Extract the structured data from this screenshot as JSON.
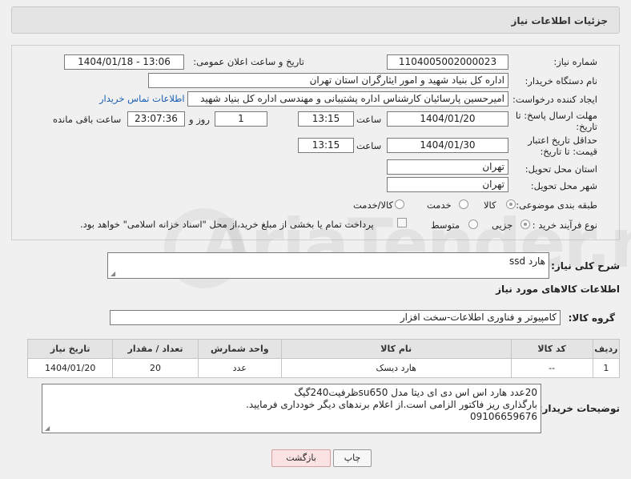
{
  "header": {
    "title": "جزئیات اطلاعات نیاز"
  },
  "form": {
    "need_number_label": "شماره نیاز:",
    "need_number": "1104005002000023",
    "announce_label": "تاریخ و ساعت اعلان عمومی:",
    "announce_value": "1404/01/18 - 13:06",
    "buyer_label": "نام دستگاه خریدار:",
    "buyer_value": "اداره کل بنیاد شهید و امور ایثارگران استان تهران",
    "creator_label": "ایجاد کننده درخواست:",
    "creator_value": "امیرحسین پارسائیان کارشناس اداره پشتیبانی و مهندسی  اداره کل بنیاد شهید",
    "contact_link": "اطلاعات تماس خریدار",
    "deadline_label": "مهلت ارسال پاسخ: تا تاریخ:",
    "deadline_date": "1404/01/20",
    "time_label": "ساعت",
    "deadline_time": "13:15",
    "days_value": "1",
    "days_label": "روز و",
    "remaining_value": "23:07:36",
    "remaining_label": "ساعت باقی مانده",
    "validity_label": "حداقل تاریخ اعتبار قیمت: تا تاریخ:",
    "validity_date": "1404/01/30",
    "validity_time": "13:15",
    "province_label": "استان محل تحویل:",
    "province_value": "تهران",
    "city_label": "شهر محل تحویل:",
    "city_value": "تهران",
    "category_label": "طبقه بندی موضوعی:",
    "category_options": [
      "کالا",
      "خدمت",
      "کالا/خدمت"
    ],
    "category_selected": "کالا",
    "process_label": "نوع فرآیند خرید :",
    "process_options": [
      "جزیی",
      "متوسط"
    ],
    "process_selected": "جزیی",
    "payment_note": "پرداخت تمام یا بخشی از مبلغ خرید،از محل \"اسناد خزانه اسلامی\" خواهد بود."
  },
  "description": {
    "label": "شرح کلی نیاز:",
    "value": "هارد ssd"
  },
  "goods_info": {
    "title": "اطلاعات کالاهای مورد نیاز",
    "group_label": "گروه کالا:",
    "group_value": "کامپیوتر و فناوری اطلاعات-سخت افزار"
  },
  "items_table": {
    "columns": [
      "ردیف",
      "کد کالا",
      "نام کالا",
      "واحد شمارش",
      "تعداد / مقدار",
      "تاریخ نیاز"
    ],
    "rows": [
      [
        "1",
        "--",
        "هارد دیسک",
        "عدد",
        "20",
        "1404/01/20"
      ]
    ]
  },
  "buyer_notes": {
    "label": "توضیحات خریدار:",
    "lines": [
      "20عدد هارد اس اس دی ای دیتا مدل su650ظرفیت240گیگ",
      "بارگذاری ریز فاکتور الزامی است.از اعلام برندهای دیگر خودداری فرمایید.",
      "09106659676"
    ]
  },
  "buttons": {
    "print": "چاپ",
    "back": "بازگشت"
  },
  "watermark": {
    "text": "AriaTender.net"
  },
  "colors": {
    "link": "#1a5fb4",
    "back_button_bg": "#fbe3e3"
  }
}
